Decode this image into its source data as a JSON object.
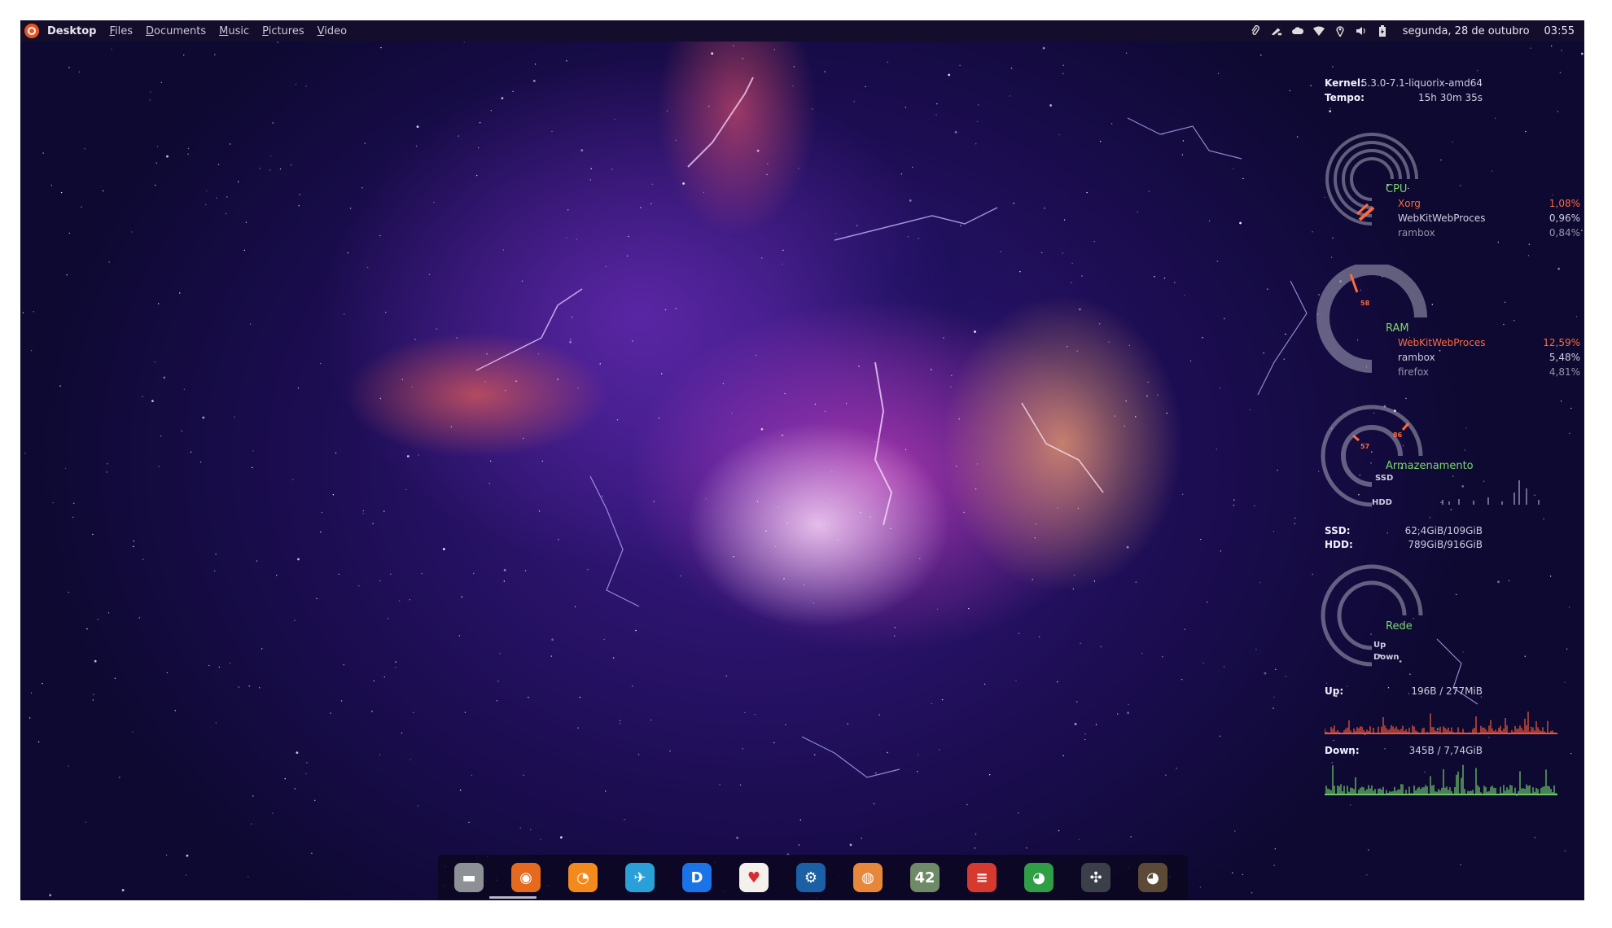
{
  "topbar": {
    "app_title": "Desktop",
    "menu": [
      {
        "u": "F",
        "rest": "iles"
      },
      {
        "u": "D",
        "rest": "ocuments"
      },
      {
        "u": "M",
        "rest": "usic"
      },
      {
        "u": "P",
        "rest": "ictures"
      },
      {
        "u": "V",
        "rest": "ideo"
      }
    ],
    "tray_icons": [
      "paperclip-icon",
      "pen-icon",
      "cloud-icon",
      "wifi-icon",
      "location-icon",
      "volume-icon",
      "battery-icon"
    ],
    "date": "segunda, 28 de outubro",
    "time": "03:55"
  },
  "conky": {
    "kernel_label": "Kernel:",
    "kernel_value": "5.3.0-7.1-liquorix-amd64",
    "uptime_label": "Tempo:",
    "uptime_value": "15h 30m 35s",
    "cpu": {
      "title": "CPU",
      "processes": [
        {
          "name": "Xorg",
          "value": "1,08%",
          "hot": true
        },
        {
          "name": "WebKitWebProces",
          "value": "0,96%",
          "hot": false
        },
        {
          "name": "rambox",
          "value": "0,84%",
          "hot": false
        }
      ]
    },
    "ram": {
      "title": "RAM",
      "gauge_label": "58",
      "gauge_percent": 58,
      "processes": [
        {
          "name": "WebKitWebProces",
          "value": "12,59%",
          "hot": true
        },
        {
          "name": "rambox",
          "value": "5,48%",
          "hot": false
        },
        {
          "name": "firefox",
          "value": "4,81%",
          "hot": false
        }
      ]
    },
    "storage": {
      "title": "Armazenamento",
      "ssd_gauge": "57",
      "hdd_gauge": "86",
      "ssd_percent": 57,
      "hdd_percent": 86,
      "ssd_short": "SSD",
      "hdd_short": "HDD",
      "ssd_label": "SSD:",
      "ssd_value": "62,4GiB/109GiB",
      "hdd_label": "HDD:",
      "hdd_value": "789GiB/916GiB"
    },
    "network": {
      "title": "Rede",
      "up_short": "Up",
      "down_short": "Down",
      "up_label": "Up:",
      "up_value": "196B  / 277MiB",
      "down_label": "Down:",
      "down_value": "345B  / 7,74GiB"
    }
  },
  "dock": {
    "apps": [
      {
        "name": "files-icon",
        "glyph": "▬",
        "bg": "#8d9196"
      },
      {
        "name": "firefox-icon",
        "glyph": "◉",
        "bg": "#e66a1d"
      },
      {
        "name": "rss-reader-icon",
        "glyph": "◔",
        "bg": "#f28a1e"
      },
      {
        "name": "telegram-bird-icon",
        "glyph": "✈",
        "bg": "#2aa0d8"
      },
      {
        "name": "deezer-d-icon",
        "glyph": "D",
        "bg": "#1b73e8"
      },
      {
        "name": "card-game-icon",
        "glyph": "♥",
        "bg": "#f4f0ec"
      },
      {
        "name": "steam-icon",
        "glyph": "⚙",
        "bg": "#1b5fa5"
      },
      {
        "name": "blender-icon",
        "glyph": "◍",
        "bg": "#e7873a"
      },
      {
        "name": "system-monitor-icon",
        "glyph": "42",
        "bg": "#6f8a66"
      },
      {
        "name": "mixer-icon",
        "glyph": "≡",
        "bg": "#d63a2f"
      },
      {
        "name": "chrome-icon",
        "glyph": "◕",
        "bg": "#2f9e45"
      },
      {
        "name": "davinci-resolve-icon",
        "glyph": "✣",
        "bg": "#3b3f4a"
      },
      {
        "name": "gimp-icon",
        "glyph": "◕",
        "bg": "#5d4a36"
      }
    ]
  }
}
